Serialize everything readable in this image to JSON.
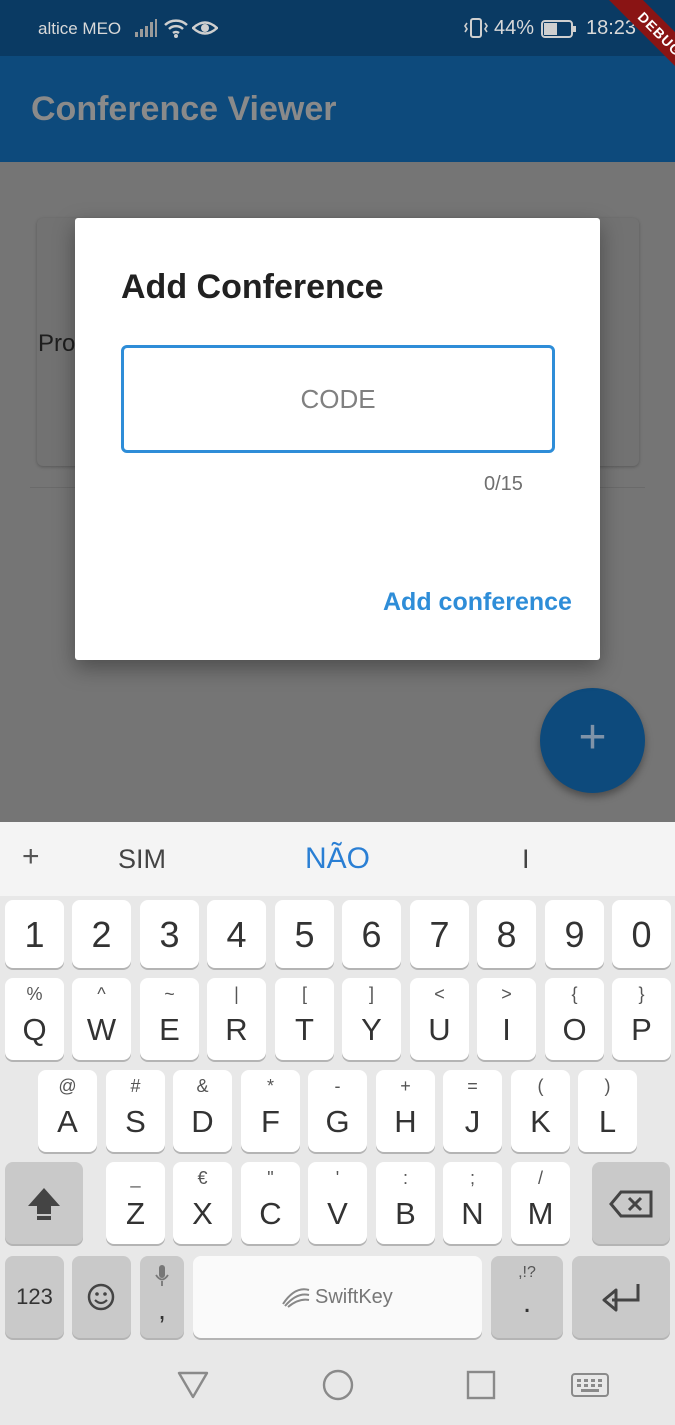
{
  "status_bar": {
    "carrier": "altice MEO",
    "battery_percent": "44%",
    "time": "18:23",
    "debug_banner": "DEBUG",
    "icons": [
      "signal-icon",
      "wifi-icon",
      "eye-icon",
      "vibrate-icon",
      "battery-icon"
    ]
  },
  "app_bar": {
    "title": "Conference Viewer"
  },
  "background": {
    "card_text": "Pro"
  },
  "dialog": {
    "title": "Add Conference",
    "input_placeholder": "CODE",
    "input_value": "",
    "counter": "0/15",
    "action_label": "Add conference"
  },
  "fab": {
    "label": "+"
  },
  "keyboard": {
    "suggestions": {
      "plus": "+",
      "items": [
        "SIM",
        "NÃO",
        "I"
      ]
    },
    "number_row": [
      "1",
      "2",
      "3",
      "4",
      "5",
      "6",
      "7",
      "8",
      "9",
      "0"
    ],
    "row1": [
      {
        "main": "Q",
        "sec": "%"
      },
      {
        "main": "W",
        "sec": "^"
      },
      {
        "main": "E",
        "sec": "~"
      },
      {
        "main": "R",
        "sec": "|"
      },
      {
        "main": "T",
        "sec": "["
      },
      {
        "main": "Y",
        "sec": "]"
      },
      {
        "main": "U",
        "sec": "<"
      },
      {
        "main": "I",
        "sec": ">"
      },
      {
        "main": "O",
        "sec": "{"
      },
      {
        "main": "P",
        "sec": "}"
      }
    ],
    "row2": [
      {
        "main": "A",
        "sec": "@"
      },
      {
        "main": "S",
        "sec": "#"
      },
      {
        "main": "D",
        "sec": "&"
      },
      {
        "main": "F",
        "sec": "*"
      },
      {
        "main": "G",
        "sec": "-"
      },
      {
        "main": "H",
        "sec": "+"
      },
      {
        "main": "J",
        "sec": "="
      },
      {
        "main": "K",
        "sec": "("
      },
      {
        "main": "L",
        "sec": ")"
      }
    ],
    "row3": [
      {
        "main": "Z",
        "sec": "_"
      },
      {
        "main": "X",
        "sec": "€"
      },
      {
        "main": "C",
        "sec": "\""
      },
      {
        "main": "V",
        "sec": "'"
      },
      {
        "main": "B",
        "sec": ":"
      },
      {
        "main": "N",
        "sec": ";"
      },
      {
        "main": "M",
        "sec": "/"
      }
    ],
    "bottom": {
      "numbers_label": "123",
      "comma": ",",
      "space_brand": "SwiftKey",
      "period": ".",
      "period_sec": ",!?"
    }
  },
  "colors": {
    "status_bar": "#0a3a63",
    "app_bar": "#0d4a7c",
    "accent": "#2e8dd8",
    "scrim": "#757575",
    "suggestion_selected": "#2a7fd4"
  }
}
